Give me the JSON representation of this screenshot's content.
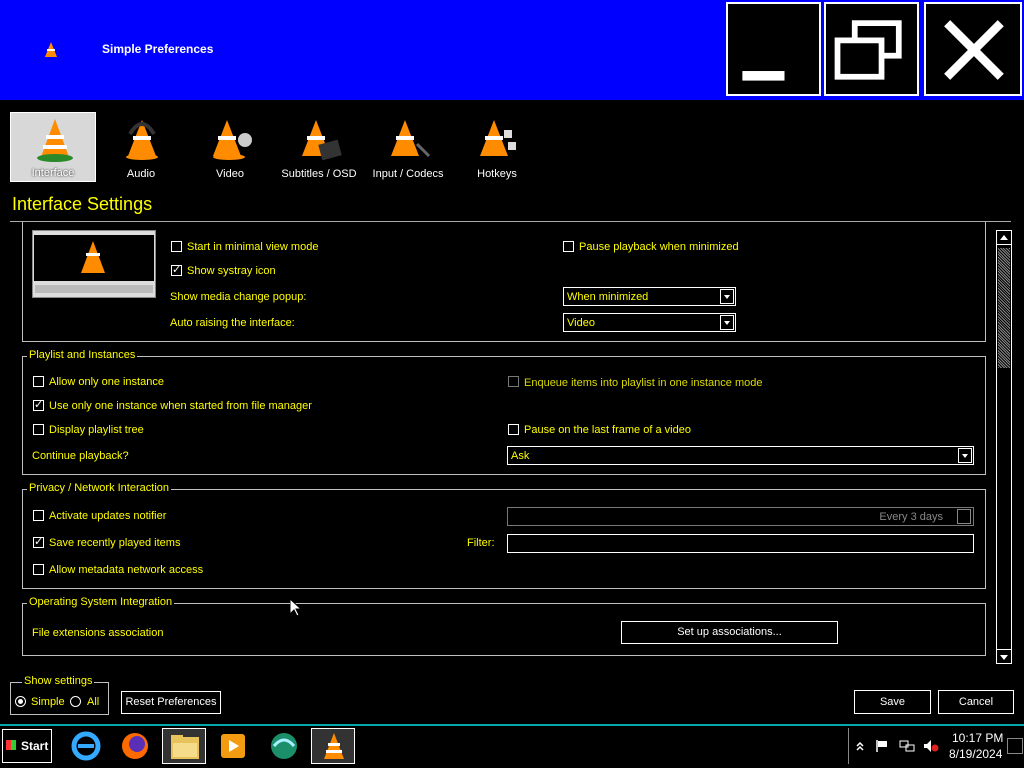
{
  "window": {
    "title": "Simple Preferences"
  },
  "categories": [
    {
      "label": "Interface",
      "selected": true
    },
    {
      "label": "Audio"
    },
    {
      "label": "Video"
    },
    {
      "label": "Subtitles / OSD"
    },
    {
      "label": "Input / Codecs"
    },
    {
      "label": "Hotkeys"
    }
  ],
  "section_title": "Interface Settings",
  "look": {
    "start_minimal": "Start in minimal view mode",
    "pause_minimized": "Pause playback when minimized",
    "systray": "Show systray icon",
    "media_popup_label": "Show media change popup:",
    "media_popup_value": "When minimized",
    "auto_raise_label": "Auto raising the interface:",
    "auto_raise_value": "Video"
  },
  "playlist": {
    "title": "Playlist and Instances",
    "one_instance": "Allow only one instance",
    "enqueue": "Enqueue items into playlist in one instance mode",
    "file_manager": "Use only one instance when started from file manager",
    "tree": "Display playlist tree",
    "pause_last": "Pause on the last frame of a video",
    "continue_label": "Continue playback?",
    "continue_value": "Ask"
  },
  "privacy": {
    "title": "Privacy / Network Interaction",
    "updates": "Activate updates notifier",
    "updates_interval": "Every 3 days",
    "recent": "Save recently played items",
    "filter_label": "Filter:",
    "filter_value": "",
    "metadata": "Allow metadata network access"
  },
  "os": {
    "title": "Operating System Integration",
    "assoc_label": "File extensions association",
    "assoc_button": "Set up associations..."
  },
  "show_settings": {
    "title": "Show settings",
    "simple": "Simple",
    "all": "All",
    "selected": "Simple"
  },
  "buttons": {
    "reset": "Reset Preferences",
    "save": "Save",
    "cancel": "Cancel"
  },
  "taskbar": {
    "start": "Start",
    "apps": [
      "internet-explorer-icon",
      "firefox-icon",
      "file-explorer-icon",
      "media-player-icon",
      "browser-globe-icon",
      "vlc-icon"
    ],
    "time": "10:17 PM",
    "date": "8/19/2024"
  },
  "colors": {
    "titlebar": "#0000ff",
    "text": "#ffff00",
    "background": "#000000",
    "cone_orange": "#ff8c00"
  }
}
